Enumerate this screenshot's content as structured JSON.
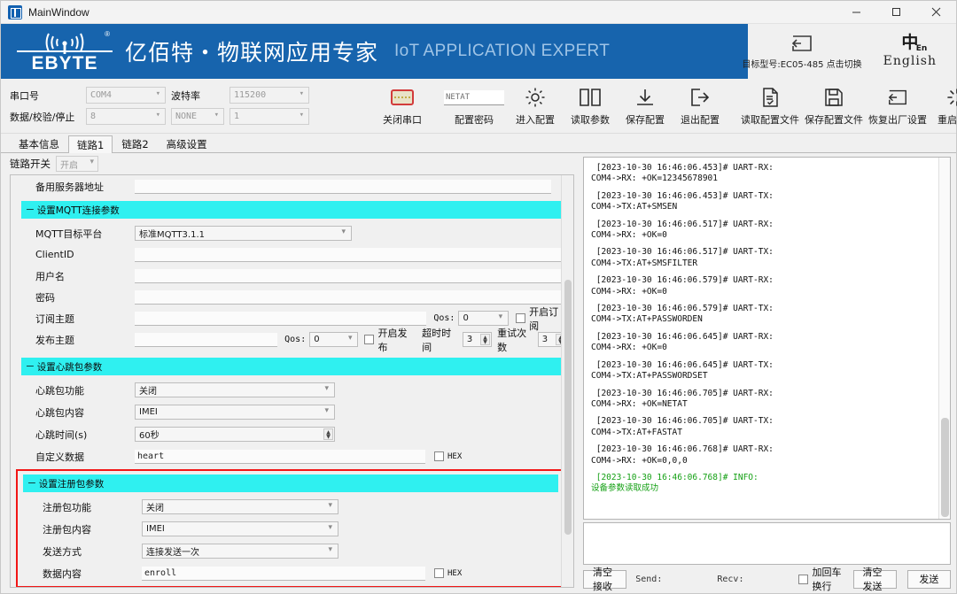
{
  "window": {
    "title": "MainWindow",
    "minimize": "–",
    "maximize": "☐",
    "close": "✕"
  },
  "banner": {
    "logo_name": "EBYTE",
    "logo_reg": "®",
    "title_cn": "亿佰特・物联网应用专家",
    "title_en": "IoT APPLICATION EXPERT",
    "model_label": "目标型号:EC05-485 点击切换",
    "lang_glyph": "中",
    "lang_sub": "En",
    "lang_text": "English"
  },
  "toolbar": {
    "serial": {
      "port_label": "串口号",
      "port_value": "COM4",
      "baud_label": "波特率",
      "baud_value": "115200",
      "format_label": "数据/校验/停止",
      "data_value": "8",
      "parity_value": "NONE",
      "stop_value": "1"
    },
    "close_serial": "关闭串口",
    "password_value": "NETAT",
    "password_label": "配置密码",
    "buttons": [
      {
        "label": "进入配置",
        "icon": "gear-icon"
      },
      {
        "label": "读取参数",
        "icon": "book-icon"
      },
      {
        "label": "保存配置",
        "icon": "download-icon"
      },
      {
        "label": "退出配置",
        "icon": "exit-icon"
      },
      {
        "label": "读取配置文件",
        "icon": "document-check-icon"
      },
      {
        "label": "保存配置文件",
        "icon": "floppy-save-icon"
      },
      {
        "label": "恢复出厂设置",
        "icon": "restore-icon"
      },
      {
        "label": "重启设备",
        "icon": "restart-icon"
      }
    ]
  },
  "tabs": [
    {
      "label": "基本信息",
      "active": false
    },
    {
      "label": "链路1",
      "active": true
    },
    {
      "label": "链路2",
      "active": false
    },
    {
      "label": "高级设置",
      "active": false
    }
  ],
  "link_switch": {
    "label": "链路开关",
    "value": "开启"
  },
  "form": {
    "backup_server": {
      "label": "备用服务器地址",
      "value": ""
    },
    "mqtt_section": "设置MQTT连接参数",
    "mqtt": {
      "platform_label": "MQTT目标平台",
      "platform_value": "标准MQTT3.1.1",
      "clientid_label": "ClientID",
      "clientid_value": "",
      "username_label": "用户名",
      "username_value": "",
      "password_label": "密码",
      "password_value": "",
      "sub_topic_label": "订阅主题",
      "sub_topic_value": "",
      "sub_qos_label": "Qos:",
      "sub_qos_value": "0",
      "sub_enable_label": "开启订阅",
      "pub_topic_label": "发布主题",
      "pub_topic_value": "",
      "pub_qos_label": "Qos:",
      "pub_qos_value": "0",
      "pub_enable_label": "开启发布",
      "timeout_label": "超时时间",
      "timeout_value": "3",
      "retry_label": "重试次数",
      "retry_value": "3"
    },
    "heartbeat_section": "设置心跳包参数",
    "heartbeat": {
      "func_label": "心跳包功能",
      "func_value": "关闭",
      "content_label": "心跳包内容",
      "content_value": "IMEI",
      "time_label": "心跳时间(s)",
      "time_value": "60秒",
      "custom_label": "自定义数据",
      "custom_value": "heart",
      "hex_label": "HEX"
    },
    "enroll_section": "设置注册包参数",
    "enroll": {
      "func_label": "注册包功能",
      "func_value": "关闭",
      "content_label": "注册包内容",
      "content_value": "IMEI",
      "mode_label": "发送方式",
      "mode_value": "连接发送一次",
      "data_label": "数据内容",
      "data_value": "enroll",
      "hex_label": "HEX"
    }
  },
  "log": {
    "entries": [
      {
        "head": "[2023-10-30 16:46:06.453]# UART-RX:",
        "body": "COM4->RX: +OK=12345678901",
        "type": "normal"
      },
      {
        "head": "[2023-10-30 16:46:06.453]# UART-TX:",
        "body": "COM4->TX:AT+SMSEN",
        "type": "normal"
      },
      {
        "head": "[2023-10-30 16:46:06.517]# UART-RX:",
        "body": "COM4->RX: +OK=0",
        "type": "normal"
      },
      {
        "head": "[2023-10-30 16:46:06.517]# UART-TX:",
        "body": "COM4->TX:AT+SMSFILTER",
        "type": "normal"
      },
      {
        "head": "[2023-10-30 16:46:06.579]# UART-RX:",
        "body": "COM4->RX: +OK=0",
        "type": "normal"
      },
      {
        "head": "[2023-10-30 16:46:06.579]# UART-TX:",
        "body": "COM4->TX:AT+PASSWORDEN",
        "type": "normal"
      },
      {
        "head": "[2023-10-30 16:46:06.645]# UART-RX:",
        "body": "COM4->RX: +OK=0",
        "type": "normal"
      },
      {
        "head": "[2023-10-30 16:46:06.645]# UART-TX:",
        "body": "COM4->TX:AT+PASSWORDSET",
        "type": "normal"
      },
      {
        "head": "[2023-10-30 16:46:06.705]# UART-RX:",
        "body": "COM4->RX: +OK=NETAT",
        "type": "normal"
      },
      {
        "head": "[2023-10-30 16:46:06.705]# UART-TX:",
        "body": "COM4->TX:AT+FASTAT",
        "type": "normal"
      },
      {
        "head": "[2023-10-30 16:46:06.768]# UART-RX:",
        "body": "COM4->RX: +OK=0,0,0",
        "type": "normal"
      },
      {
        "head": "[2023-10-30 16:46:06.768]# INFO:",
        "body": "设备参数读取成功",
        "type": "info"
      }
    ]
  },
  "bottom": {
    "clear_recv": "清空接收",
    "send_stat": "Send:",
    "recv_stat": "Recv:",
    "crlf_label": "加回车换行",
    "clear_send": "清空发送",
    "send": "发送"
  },
  "send_input": {
    "value": ""
  },
  "colors": {
    "banner_blue": "#1764ad",
    "section_cyan": "#2ff0f0",
    "highlight_red": "#f21616",
    "info_green": "#14a014"
  }
}
